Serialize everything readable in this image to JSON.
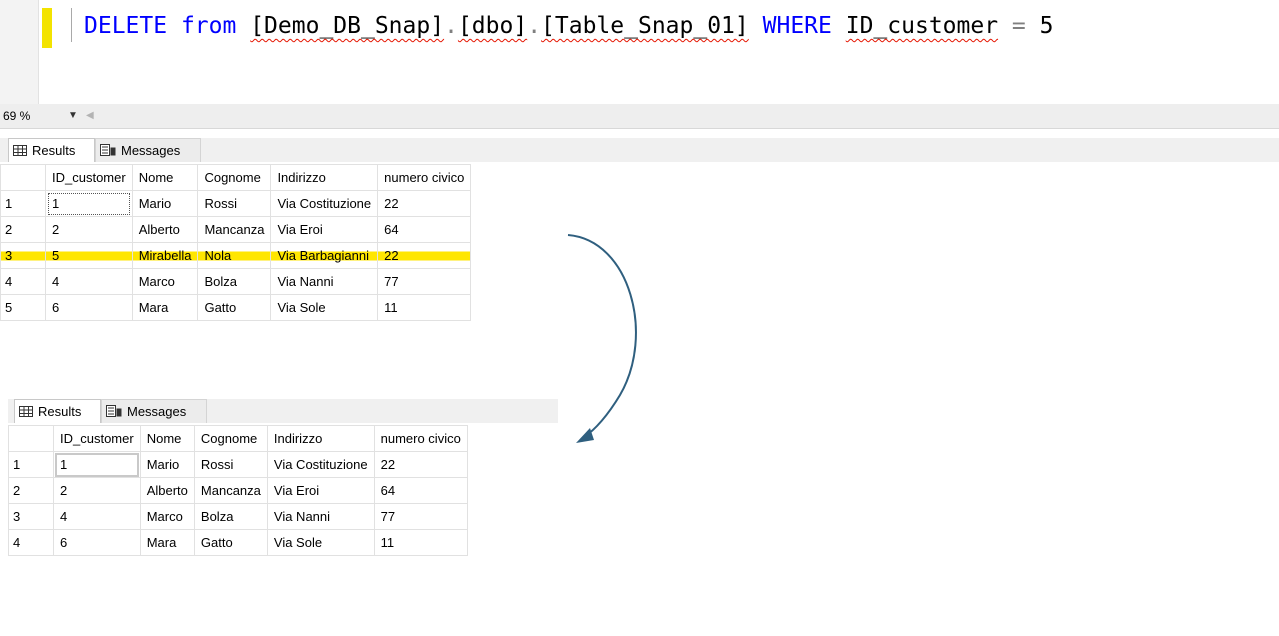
{
  "editor": {
    "tokens": [
      {
        "text": "DELETE",
        "cls": "kw"
      },
      {
        "text": " ",
        "cls": ""
      },
      {
        "text": "from",
        "cls": "kw"
      },
      {
        "text": " ",
        "cls": ""
      },
      {
        "text": "[Demo_DB_Snap]",
        "cls": "sq"
      },
      {
        "text": ".",
        "cls": "op"
      },
      {
        "text": "[dbo]",
        "cls": "sq"
      },
      {
        "text": ".",
        "cls": "op"
      },
      {
        "text": "[Table_Snap_01]",
        "cls": "sq"
      },
      {
        "text": " ",
        "cls": ""
      },
      {
        "text": "WHERE",
        "cls": "kw"
      },
      {
        "text": " ",
        "cls": ""
      },
      {
        "text": "ID_customer",
        "cls": "sq"
      },
      {
        "text": " ",
        "cls": ""
      },
      {
        "text": "=",
        "cls": "op"
      },
      {
        "text": " 5",
        "cls": ""
      }
    ]
  },
  "zoom": {
    "value": "69 %"
  },
  "before": {
    "tabs": {
      "results": "Results",
      "messages": "Messages"
    },
    "columns": [
      "ID_customer",
      "Nome",
      "Cognome",
      "Indirizzo",
      "numero civico"
    ],
    "rows": [
      {
        "n": "1",
        "cells": [
          "1",
          "Mario",
          "Rossi",
          "Via Costituzione",
          "22"
        ]
      },
      {
        "n": "2",
        "cells": [
          "2",
          "Alberto",
          "Mancanza",
          "Via Eroi",
          "64"
        ]
      },
      {
        "n": "3",
        "cells": [
          "5",
          "Mirabella",
          "Nola",
          "Via Barbagianni",
          "22"
        ],
        "highlight": true
      },
      {
        "n": "4",
        "cells": [
          "4",
          "Marco",
          "Bolza",
          "Via Nanni",
          "77"
        ]
      },
      {
        "n": "5",
        "cells": [
          "6",
          "Mara",
          "Gatto",
          "Via Sole",
          "11"
        ]
      }
    ]
  },
  "after": {
    "tabs": {
      "results": "Results",
      "messages": "Messages"
    },
    "columns": [
      "ID_customer",
      "Nome",
      "Cognome",
      "Indirizzo",
      "numero civico"
    ],
    "rows": [
      {
        "n": "1",
        "cells": [
          "1",
          "Mario",
          "Rossi",
          "Via Costituzione",
          "22"
        ]
      },
      {
        "n": "2",
        "cells": [
          "2",
          "Alberto",
          "Mancanza",
          "Via Eroi",
          "64"
        ]
      },
      {
        "n": "3",
        "cells": [
          "4",
          "Marco",
          "Bolza",
          "Via Nanni",
          "77"
        ]
      },
      {
        "n": "4",
        "cells": [
          "6",
          "Mara",
          "Gatto",
          "Via Sole",
          "11"
        ]
      }
    ]
  },
  "colors": {
    "highlight": "#ffe600",
    "keyword": "#0000ff",
    "arrow": "#2f5f7f",
    "squiggle": "#e51400"
  }
}
